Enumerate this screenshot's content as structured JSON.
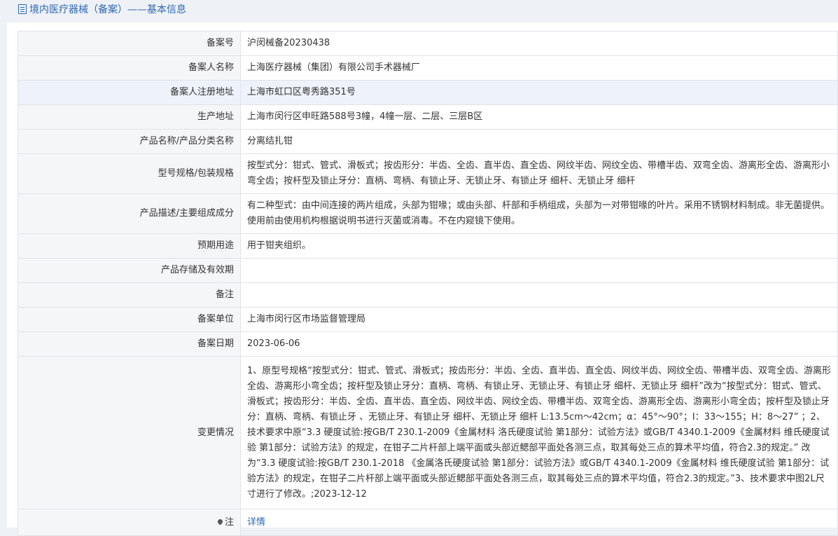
{
  "header": {
    "title": "境内医疗器械（备案）——基本信息"
  },
  "rows": [
    {
      "label": "备案号",
      "value": "沪闵械备20230438"
    },
    {
      "label": "备案人名称",
      "value": "上海医疗器械（集团）有限公司手术器械厂"
    },
    {
      "label": "备案人注册地址",
      "value": "上海市虹口区粤秀路351号"
    },
    {
      "label": "生产地址",
      "value": "上海市闵行区申旺路588号3幢，4幢一层、二层、三层B区"
    },
    {
      "label": "产品名称/产品分类名称",
      "value": "分离结扎钳"
    },
    {
      "label": "型号规格/包装规格",
      "value": "按型式分：钳式、管式、滑板式；按齿形分：半齿、全齿、直半齿、直全齿、网纹半齿、网纹全齿、带槽半齿、双弯全齿、游离形全齿、游离形小弯全齿；按杆型及锁止牙分：直柄、弯柄、有锁止牙、无锁止牙、有锁止牙 细杆、无锁止牙 细杆"
    },
    {
      "label": "产品描述/主要组成成分",
      "value": "有二种型式：由中间连接的两片组成，头部为钳喙；或由头部、杆部和手柄组成，头部为一对带钳喙的叶片。采用不锈钢材料制成。非无菌提供。使用前由使用机构根据说明书进行灭菌或消毒。不在内窥镜下使用。"
    },
    {
      "label": "预期用途",
      "value": "用于钳夹组织。"
    },
    {
      "label": "产品存储及有效期",
      "value": ""
    },
    {
      "label": "备注",
      "value": ""
    },
    {
      "label": "备案单位",
      "value": "上海市闵行区市场监督管理局"
    },
    {
      "label": "备案日期",
      "value": "2023-06-06"
    },
    {
      "label": "变更情况",
      "value": "1、原型号规格“按型式分：钳式、管式、滑板式；按齿形分：半齿、全齿、直半齿、直全齿、网纹半齿、网纹全齿、带槽半齿、双弯全齿、游离形全齿、游离形小弯全齿；按杆型及锁止牙分：直柄、弯柄、有锁止牙、无锁止牙、有锁止牙 细杆、无锁止牙 细杆”改为“按型式分：钳式、管式、滑板式；按齿形分：半齿、全齿、直半齿、直全齿、网纹半齿、网纹全齿、带槽半齿、双弯全齿、游离形全齿、游离形小弯全齿；按杆型及锁止牙分：直柄、弯柄、有锁止牙 、无锁止牙、有锁止牙 细杆、无锁止牙 细杆 L:13.5cm～42cm；α：45°～90°；I：33～155；H：8～27” ；2、技术要求中原“3.3 硬度试验:按GB/T 230.1-2009《金属材料 洛氏硬度试验 第1部分：试验方法》或GB/T 4340.1-2009《金属材料 维氏硬度试验 第1部分：试验方法》的规定，在钳子二片杆部上端平面或头部近鳃部平面处各测三点，取其每处三点的算术平均值，符合2.3的规定。” 改为“3.3 硬度试验:按GB/T 230.1-2018 《金属洛氏硬度试验 第1部分：试验方法》或GB/T 4340.1-2009《金属材料 维氏硬度试验 第1部分：试验方法》的规定，在钳子二片杆部上端平面或头部近鳃部平面处各测三点，取其每处三点的算术平均值，符合2.3的规定。”3、技术要求中图2L尺寸进行了修改。;2023-12-12"
    }
  ],
  "note": {
    "label": "注",
    "link": "详情"
  }
}
